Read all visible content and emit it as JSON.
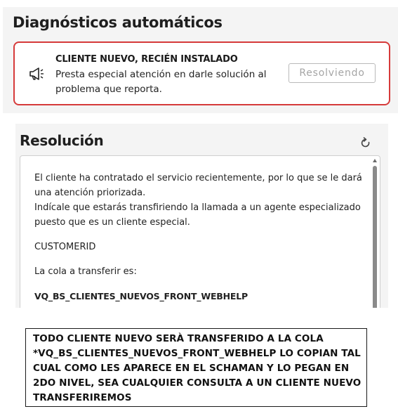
{
  "diagnostics": {
    "title": "Diagnósticos automáticos",
    "alert": {
      "heading": "CLIENTE NUEVO, RECIÉN INSTALADO",
      "body": "Presta especial atención en darle solución al problema que reporta.",
      "button_label": "Resolviendo",
      "icon": "megaphone-icon",
      "border_color": "#d63a3a"
    }
  },
  "resolution": {
    "title": "Resolución",
    "refresh_icon": "refresh-icon",
    "paragraph_1": "El cliente ha contratado el servicio recientemente, por lo que se le dará una atención priorizada.",
    "paragraph_2": "Indícale que estarás transfiriendo la llamada a un agente especializado puesto que es un cliente especial.",
    "paragraph_3": "CUSTOMERID",
    "paragraph_4": "La cola a transferir es:",
    "paragraph_5": "VQ_BS_CLIENTES_NUEVOS_FRONT_WEBHELP"
  },
  "note": {
    "text": "TODO CLIENTE NUEVO SERÀ TRANSFERIDO A LA COLA *VQ_BS_CLIENTES_NUEVOS_FRONT_WEBHELP LO COPIAN TAL CUAL COMO LES APARECE EN EL SCHAMAN Y LO PEGAN EN 2DO NIVEL, SEA CUALQUIER CONSULTA A UN CLIENTE NUEVO TRANSFERIREMOS"
  }
}
